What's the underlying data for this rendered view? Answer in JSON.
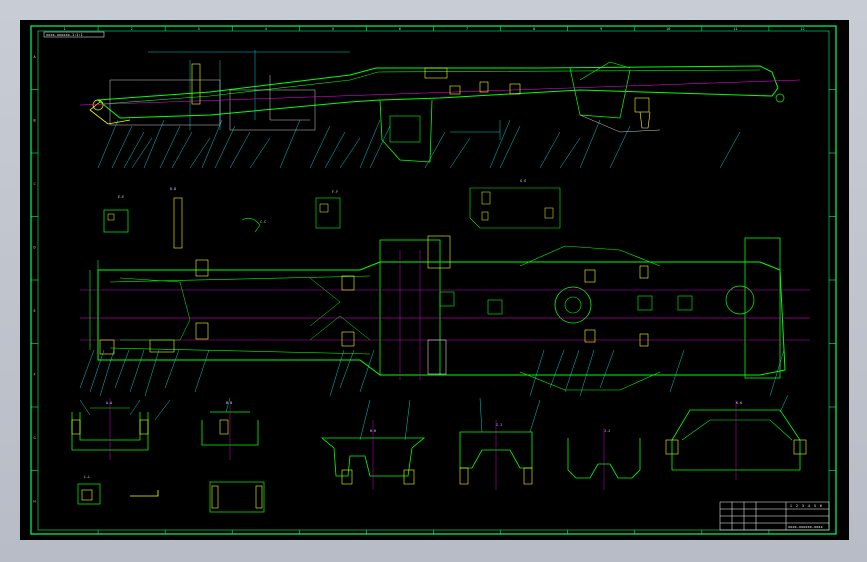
{
  "drawing": {
    "background": "#000000",
    "line_colors": {
      "outline": "#00ff00",
      "centerline": "#ff00ff",
      "dimension": "#00ffff",
      "hidden": "#ffff00",
      "border": "#00ff66",
      "frame": "#ffffff"
    },
    "tag_top_left": "xxxx-xxxxxx-1:1:1",
    "title_block": {
      "drawing_no": "xxxx-xxxxxx-xxxx",
      "row_marks": [
        "1",
        "2",
        "3",
        "4",
        "5",
        "6"
      ]
    },
    "section_labels": [
      "A-A",
      "B-B",
      "C-C",
      "D-D",
      "E-E",
      "F-F",
      "G-G",
      "H-H",
      "I-I",
      "J-J",
      "K-K",
      "L-L"
    ],
    "border_col_labels": [
      "1",
      "2",
      "3",
      "4",
      "5",
      "6",
      "7",
      "8",
      "9",
      "10",
      "11",
      "12"
    ],
    "border_row_labels": [
      "A",
      "B",
      "C",
      "D",
      "E",
      "F",
      "G",
      "H"
    ]
  }
}
